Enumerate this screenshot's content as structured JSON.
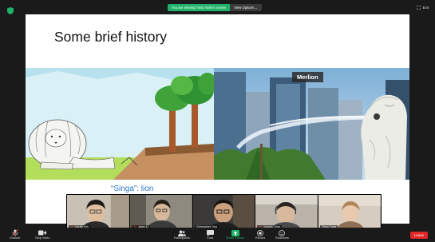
{
  "top": {
    "share_message": "You are viewing Timlo Tonle's screen",
    "view_options": "View Options ⌄",
    "exit_fullscreen": "Exit"
  },
  "slide": {
    "title": "Some brief history",
    "photo_label": "Merlion",
    "caption": "“Singa”: lion"
  },
  "participants": [
    {
      "name": "Lin-lin Kim",
      "muted": true
    },
    {
      "name": "Jacky Li",
      "muted": true
    },
    {
      "name": "Christopher Ong",
      "muted": false
    },
    {
      "name": "Lincoln Tong",
      "muted": true
    },
    {
      "name": "Timlo Tonle",
      "muted": false
    }
  ],
  "toolbar": {
    "unmute": "Unmute",
    "stop_video": "Stop Video",
    "participants": "Participants",
    "participants_count": "5",
    "chat": "Chat",
    "share_screen": "Share Screen",
    "record": "Record",
    "reactions": "Reactions",
    "leave": "Leave"
  },
  "colors": {
    "share_green": "#21b36b",
    "leave_red": "#e02828",
    "caption_blue": "#2e79c4"
  }
}
